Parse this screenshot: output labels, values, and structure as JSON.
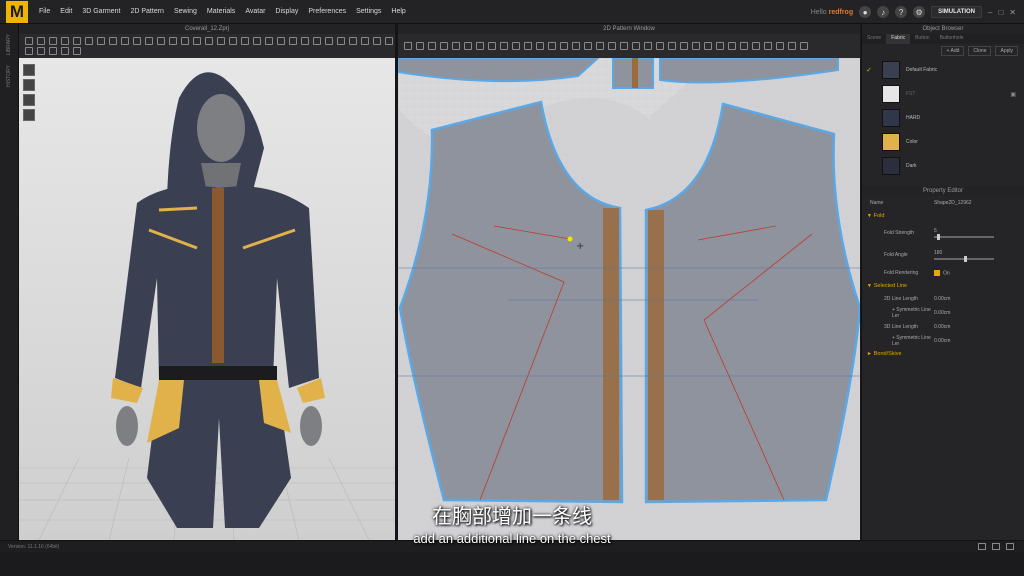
{
  "menubar": {
    "logo": "M",
    "items": [
      "File",
      "Edit",
      "3D Garment",
      "2D Pattern",
      "Sewing",
      "Materials",
      "Avatar",
      "Display",
      "Preferences",
      "Settings",
      "Help"
    ],
    "user_prefix": "Hello",
    "user_name": "redfrog",
    "simulation_label": "SIMULATION"
  },
  "left_strip": {
    "labels": [
      "LIBRARY",
      "HISTORY"
    ]
  },
  "pane3d": {
    "title": "Coverall_12.Zprj"
  },
  "pane2d": {
    "title": "2D Pattern Window"
  },
  "object_browser": {
    "title": "Object Browser",
    "tabs": [
      "Scene",
      "Fabric",
      "Button",
      "Buttonhole"
    ],
    "active_tab": "Fabric",
    "actions": [
      "+ Add",
      "Clone",
      "Apply"
    ],
    "fabrics": [
      {
        "name": "Default Fabric",
        "color": "#3a3f52",
        "checked": true
      },
      {
        "name": "FST",
        "color": "#e6e6e6",
        "checked": false
      },
      {
        "name": "HARD",
        "color": "#31374a",
        "checked": false
      },
      {
        "name": "Color",
        "color": "#e2b24a",
        "checked": false
      },
      {
        "name": "Dark",
        "color": "#2b2f3d",
        "checked": false
      }
    ]
  },
  "property_editor": {
    "title": "Property Editor",
    "name_label": "Name",
    "name_value": "Shape2D_12962",
    "fold_section": "Fold",
    "fold_strength_label": "Fold Strength",
    "fold_strength_value": "5",
    "fold_angle_label": "Fold Angle",
    "fold_angle_value": "180",
    "fold_rendering_label": "Fold Rendering",
    "fold_rendering_value": "On",
    "selected_line_section": "Selected Line",
    "line_2d_label": "2D Line Length",
    "line_2d_value": "0.00cm",
    "sym_2d_label": "+ Symmetric Line Ler",
    "sym_2d_value": "0.00cm",
    "line_3d_label": "3D Line Length",
    "line_3d_value": "0.00cm",
    "sym_3d_label": "+ Symmetric Line Ler",
    "sym_3d_value": "0.00cm",
    "bond_section": "Bond/Skive"
  },
  "statusbar": {
    "version": "Version: 11.1.16 (64bit)"
  },
  "subtitles": {
    "zh": "在胸部增加一条线",
    "en": "add an additional line on the chest"
  }
}
